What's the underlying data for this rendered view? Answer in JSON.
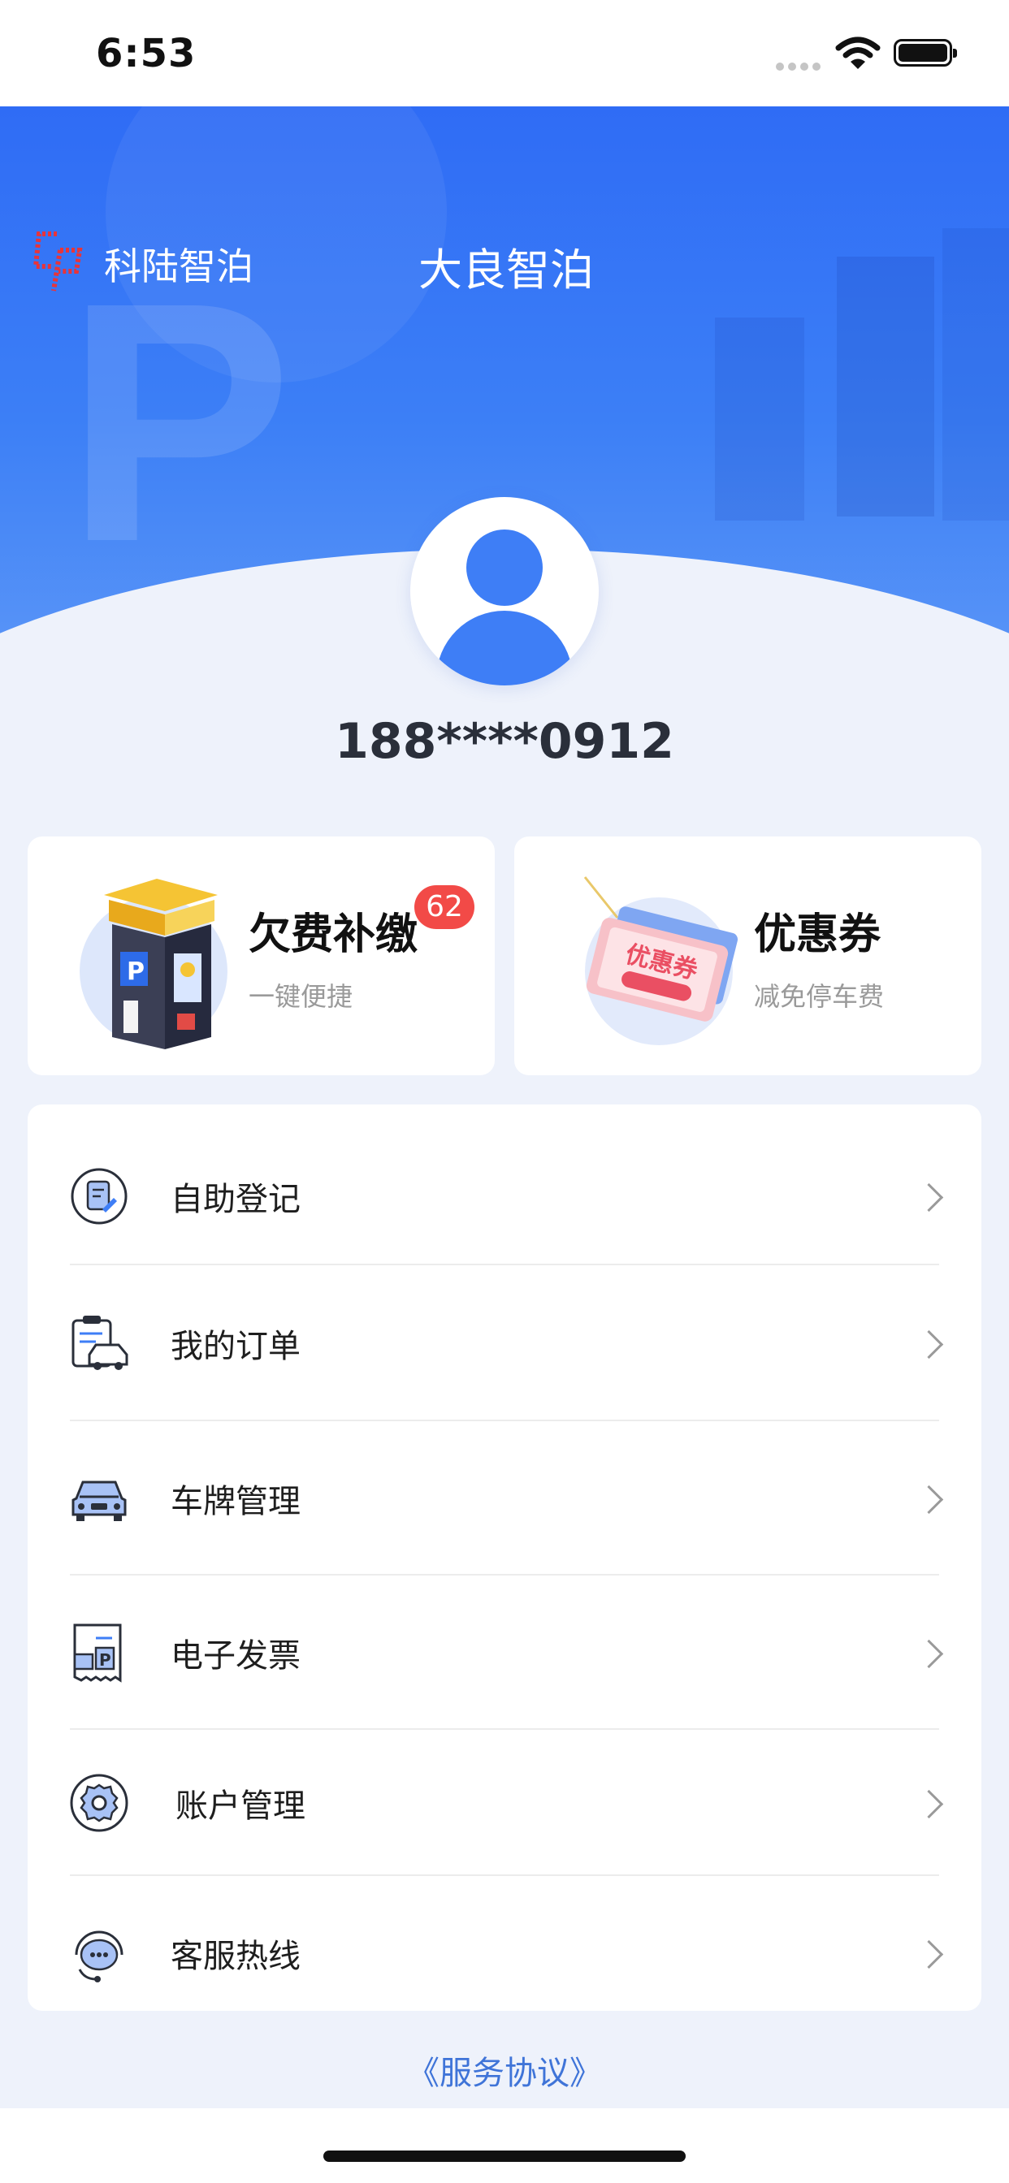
{
  "status_bar": {
    "time": "6:53"
  },
  "header": {
    "brand_name": "科陆智泊",
    "title": "大良智泊"
  },
  "profile": {
    "phone": "188****0912"
  },
  "cards": [
    {
      "title": "欠费补缴",
      "subtitle": "一键便捷",
      "badge": "62"
    },
    {
      "title": "优惠券",
      "subtitle": "减免停车费"
    }
  ],
  "menu": [
    {
      "label": "自助登记",
      "icon": "form-icon"
    },
    {
      "label": "我的订单",
      "icon": "order-car-icon"
    },
    {
      "label": "车牌管理",
      "icon": "car-icon"
    },
    {
      "label": "电子发票",
      "icon": "invoice-icon"
    },
    {
      "label": "账户管理",
      "icon": "gear-icon"
    },
    {
      "label": "客服热线",
      "icon": "headset-chat-icon"
    }
  ],
  "footer": {
    "agreement": "《服务协议》"
  },
  "colors": {
    "primary": "#3e7ef6",
    "badge": "#f24a47",
    "link": "#3f74d8"
  }
}
